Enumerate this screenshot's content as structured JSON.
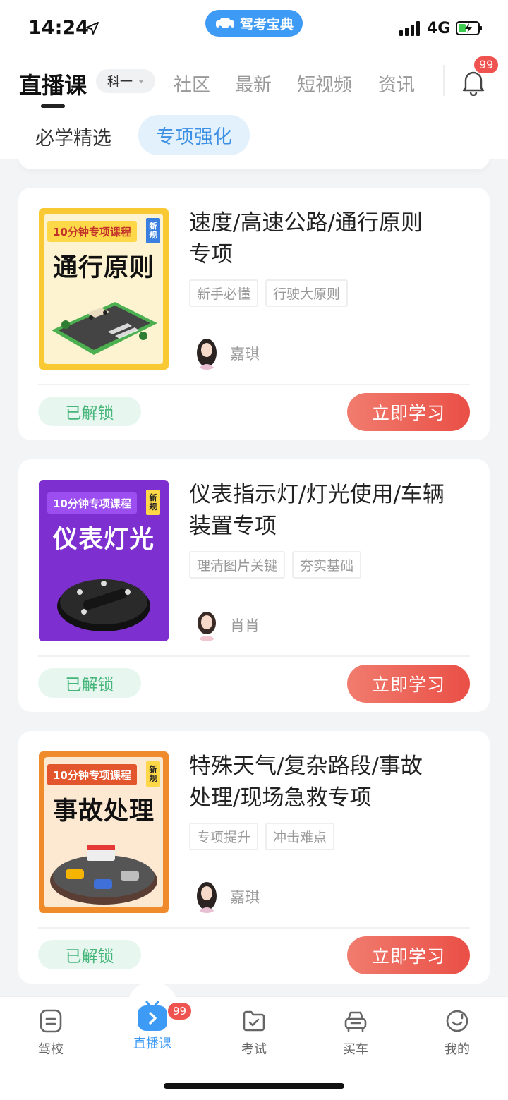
{
  "status_bar": {
    "time": "14:24",
    "app_pill": "驾考宝典",
    "network": "4G"
  },
  "top_nav": {
    "active_tab": "直播课",
    "subject": "科一",
    "tabs": [
      "社区",
      "最新",
      "短视频",
      "资讯"
    ],
    "notification_count": "99"
  },
  "sub_tabs": {
    "items": [
      "必学精选",
      "专项强化"
    ],
    "active_index": 1
  },
  "courses": [
    {
      "cover_tagline": "10分钟专项课程",
      "cover_new": "新规",
      "cover_title": "通行原则",
      "cover_color": "#f9c933",
      "title_line1": "速度/高速公路/通行原则",
      "title_line2": "专项",
      "tags": [
        "新手必懂",
        "行驶大原则"
      ],
      "teacher": "嘉琪",
      "status": "已解锁",
      "action": "立即学习"
    },
    {
      "cover_tagline": "10分钟专项课程",
      "cover_new": "新规",
      "cover_title": "仪表灯光",
      "cover_color": "#7e2fd0",
      "title_line1": "仪表指示灯/灯光使用/车辆",
      "title_line2": "装置专项",
      "tags": [
        "理清图片关键",
        "夯实基础"
      ],
      "teacher": "肖肖",
      "status": "已解锁",
      "action": "立即学习"
    },
    {
      "cover_tagline": "10分钟专项课程",
      "cover_new": "新规",
      "cover_title": "事故处理",
      "cover_color": "#f08b2c",
      "title_line1": "特殊天气/复杂路段/事故",
      "title_line2": "处理/现场急救专项",
      "tags": [
        "专项提升",
        "冲击难点"
      ],
      "teacher": "嘉琪",
      "status": "已解锁",
      "action": "立即学习"
    }
  ],
  "tab_bar": {
    "items": [
      {
        "label": "驾校",
        "icon": "school-icon"
      },
      {
        "label": "直播课",
        "icon": "live-tv-icon",
        "badge": "99"
      },
      {
        "label": "考试",
        "icon": "exam-folder-icon"
      },
      {
        "label": "买车",
        "icon": "car-icon"
      },
      {
        "label": "我的",
        "icon": "profile-smile-icon"
      }
    ],
    "active_index": 1
  },
  "colors": {
    "accent_blue": "#3d9af5",
    "action_red": "#ea4f46",
    "unlocked_green": "#46b57a"
  }
}
